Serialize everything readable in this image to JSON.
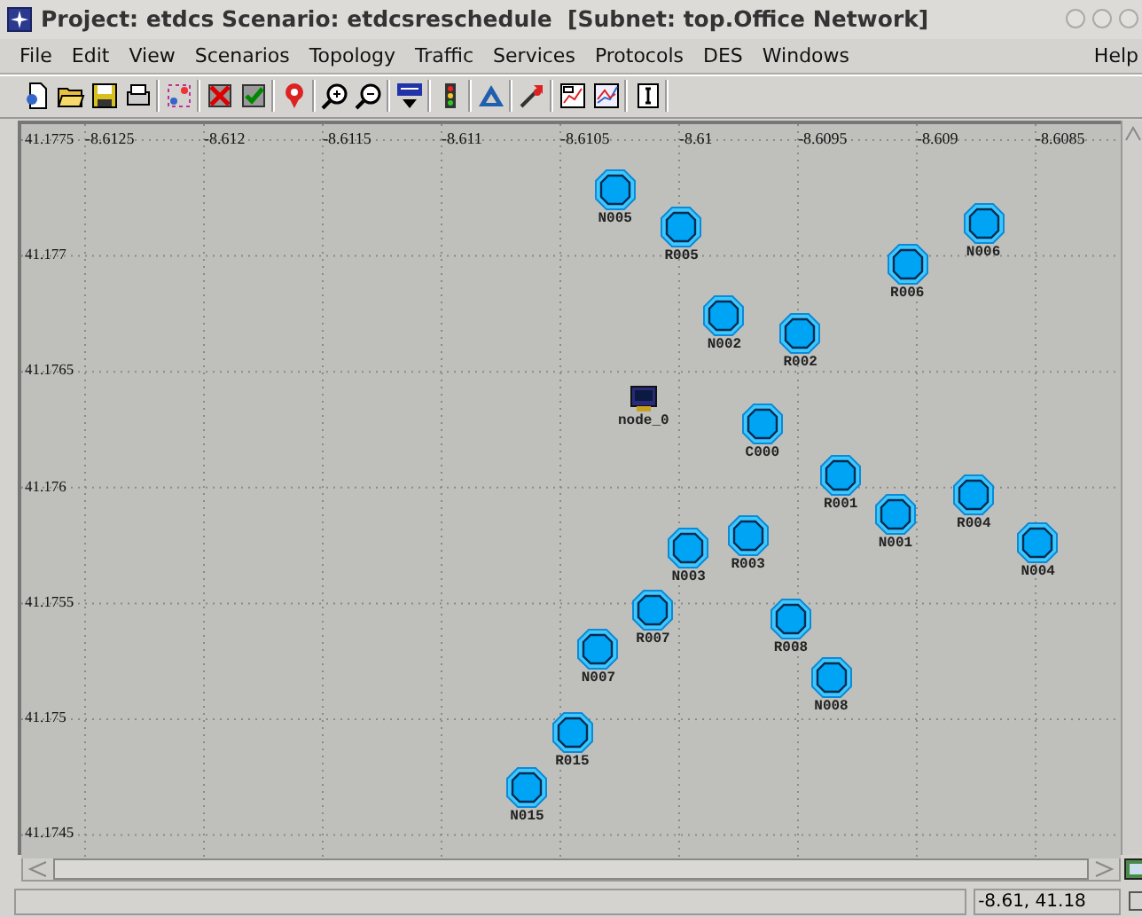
{
  "window": {
    "title": "Project: etdcs Scenario: etdcsreschedule  [Subnet: top.Office Network]"
  },
  "menu": [
    {
      "label": "File"
    },
    {
      "label": "Edit"
    },
    {
      "label": "View"
    },
    {
      "label": "Scenarios"
    },
    {
      "label": "Topology"
    },
    {
      "label": "Traffic"
    },
    {
      "label": "Services"
    },
    {
      "label": "Protocols"
    },
    {
      "label": "DES"
    },
    {
      "label": "Windows"
    }
  ],
  "help_menu": {
    "label": "Help"
  },
  "map": {
    "xticks": [
      "-8.6125",
      "-8.612",
      "-8.6115",
      "-8.611",
      "-8.6105",
      "-8.61",
      "-8.6095",
      "-8.609",
      "-8.6085"
    ],
    "yticks": [
      "41.1775",
      "41.177",
      "41.1765",
      "41.176",
      "41.1755",
      "41.175",
      "41.1745"
    ],
    "nodes": [
      {
        "name": "N005",
        "kind": "router"
      },
      {
        "name": "R005",
        "kind": "router"
      },
      {
        "name": "N006",
        "kind": "router"
      },
      {
        "name": "R006",
        "kind": "router"
      },
      {
        "name": "N002",
        "kind": "router"
      },
      {
        "name": "R002",
        "kind": "router"
      },
      {
        "name": "node_0",
        "kind": "workstation"
      },
      {
        "name": "C000",
        "kind": "router"
      },
      {
        "name": "R001",
        "kind": "router"
      },
      {
        "name": "R004",
        "kind": "router"
      },
      {
        "name": "N001",
        "kind": "router"
      },
      {
        "name": "R003",
        "kind": "router"
      },
      {
        "name": "N003",
        "kind": "router"
      },
      {
        "name": "N004",
        "kind": "router"
      },
      {
        "name": "R007",
        "kind": "router"
      },
      {
        "name": "R008",
        "kind": "router"
      },
      {
        "name": "N007",
        "kind": "router"
      },
      {
        "name": "N008",
        "kind": "router"
      },
      {
        "name": "R015",
        "kind": "router"
      },
      {
        "name": "N015",
        "kind": "router"
      }
    ]
  },
  "status_bar": {
    "coordinates": "-8.61, 41.18"
  }
}
